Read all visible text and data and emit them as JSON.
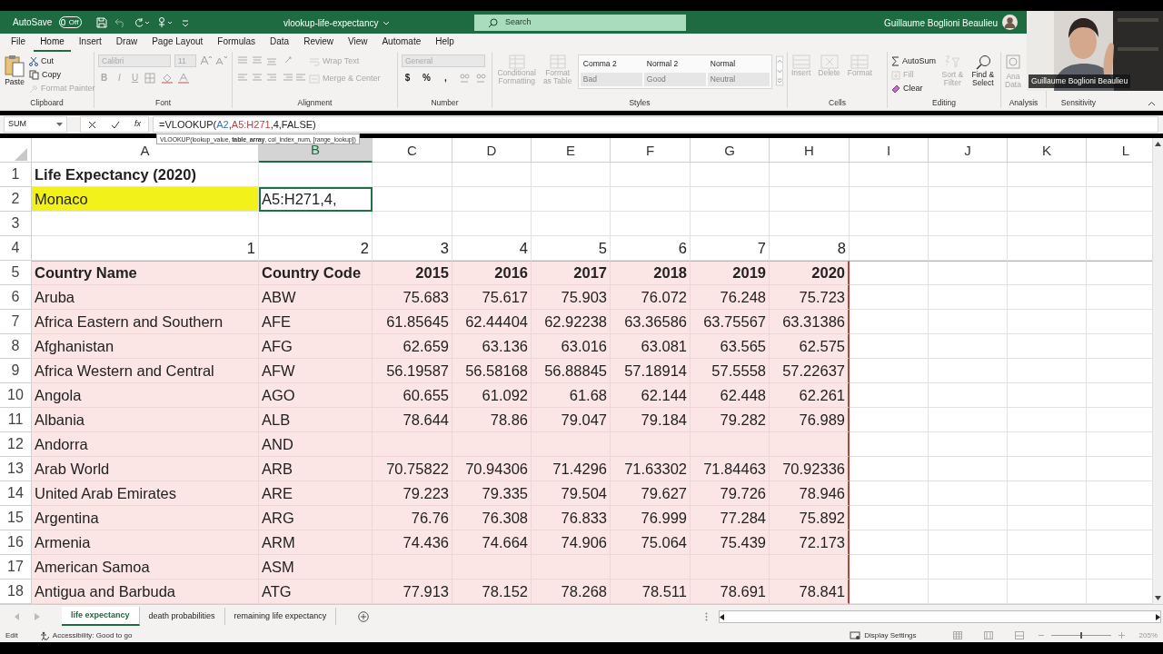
{
  "title_bar": {
    "autosave": "AutoSave",
    "autosave_toggle": {
      "label": "Off",
      "on": false
    },
    "file_name": "vlookup-life-expectancy",
    "search": {
      "placeholder": "Search"
    },
    "user": "Guillaume Boglioni Beaulieu"
  },
  "menu": [
    {
      "label": "File",
      "selected": false
    },
    {
      "label": "Home",
      "selected": true
    },
    {
      "label": "Insert",
      "selected": false
    },
    {
      "label": "Draw",
      "selected": false
    },
    {
      "label": "Page Layout",
      "selected": false
    },
    {
      "label": "Formulas",
      "selected": false
    },
    {
      "label": "Data",
      "selected": false
    },
    {
      "label": "Review",
      "selected": false
    },
    {
      "label": "View",
      "selected": false
    },
    {
      "label": "Automate",
      "selected": false
    },
    {
      "label": "Help",
      "selected": false
    }
  ],
  "ribbon": {
    "groups": [
      {
        "label": "Clipboard",
        "controls": [
          {
            "label": "Paste",
            "disabled": false
          },
          {
            "label": "Cut",
            "disabled": false
          },
          {
            "label": "Copy",
            "disabled": false
          },
          {
            "label": "Format Painter",
            "disabled": true
          }
        ]
      },
      {
        "label": "Font",
        "controls": [
          {
            "label": "Calibri",
            "disabled": true
          },
          {
            "label": "11",
            "disabled": true
          },
          {
            "label": "B",
            "disabled": true
          },
          {
            "label": "I",
            "disabled": true
          },
          {
            "label": "U",
            "disabled": true
          }
        ]
      },
      {
        "label": "Alignment",
        "controls": [
          {
            "label": "Wrap Text",
            "disabled": true
          },
          {
            "label": "Merge & Center",
            "disabled": true
          }
        ]
      },
      {
        "label": "Number",
        "controls": [
          {
            "label": "General",
            "disabled": true
          },
          {
            "label": "$",
            "disabled": false
          },
          {
            "label": "%",
            "disabled": false
          },
          {
            "label": ",",
            "disabled": false
          }
        ]
      },
      {
        "label": "Styles",
        "controls": [
          {
            "label": "Conditional Formatting",
            "disabled": true
          },
          {
            "label": "Format as Table",
            "disabled": true
          }
        ],
        "gallery": [
          {
            "label": "Comma 2",
            "disabled": false
          },
          {
            "label": "Normal 2",
            "disabled": false
          },
          {
            "label": "Normal",
            "disabled": false
          },
          {
            "label": "Bad",
            "disabled": true
          },
          {
            "label": "Good",
            "disabled": true
          },
          {
            "label": "Neutral",
            "disabled": true
          }
        ]
      },
      {
        "label": "Cells",
        "controls": [
          {
            "label": "Insert",
            "disabled": true
          },
          {
            "label": "Delete",
            "disabled": true
          },
          {
            "label": "Format",
            "disabled": true
          }
        ]
      },
      {
        "label": "Editing",
        "controls": [
          {
            "label": "AutoSum",
            "disabled": false
          },
          {
            "label": "Fill",
            "disabled": true
          },
          {
            "label": "Clear",
            "disabled": false
          },
          {
            "label": "Sort & Filter",
            "disabled": true
          },
          {
            "label": "Find & Select",
            "disabled": false
          }
        ]
      },
      {
        "label": "Analysis",
        "controls": [
          {
            "label": "Ana",
            "disabled": true
          },
          {
            "label": "Data",
            "disabled": true
          }
        ]
      },
      {
        "label": "Sensitivity"
      }
    ]
  },
  "formula_bar": {
    "name_box": "SUM",
    "function_button": "fx",
    "formula": [
      {
        "text": "=VLOOKUP("
      },
      {
        "text": "A2",
        "color": "#3f6fb5"
      },
      {
        "text": ","
      },
      {
        "text": "A5:H271",
        "color": "#b5404a"
      },
      {
        "text": ",4,FALSE)"
      }
    ],
    "tooltip": "VLOOKUP(lookup_value, **table_array**, col_index_num, [range_lookup])"
  },
  "sheet": {
    "columns": [
      {
        "label": "A",
        "selected": false
      },
      {
        "label": "B",
        "selected": true
      },
      {
        "label": "C",
        "selected": false
      },
      {
        "label": "D",
        "selected": false
      },
      {
        "label": "E",
        "selected": false
      },
      {
        "label": "F",
        "selected": false
      },
      {
        "label": "G",
        "selected": false
      },
      {
        "label": "H",
        "selected": false
      },
      {
        "label": "I",
        "selected": false
      },
      {
        "label": "J",
        "selected": false
      },
      {
        "label": "K",
        "selected": false
      },
      {
        "label": "L",
        "selected": false
      }
    ],
    "rows": [
      {
        "number": "1",
        "kind": "title",
        "cells": [
          "Life Expectancy (2020)"
        ]
      },
      {
        "number": "2",
        "kind": "input",
        "cells": [
          "Monaco",
          "A5:H271,4,"
        ]
      },
      {
        "number": "3",
        "kind": "blank"
      },
      {
        "number": "4",
        "kind": "index",
        "cells": [
          "1",
          "2",
          "3",
          "4",
          "5",
          "6",
          "7",
          "8"
        ]
      },
      {
        "number": "5",
        "kind": "header",
        "cells": [
          "Country Name",
          "Country Code",
          "2015",
          "2016",
          "2017",
          "2018",
          "2019",
          "2020"
        ]
      },
      {
        "number": "6",
        "kind": "data",
        "cells": [
          "Aruba",
          "ABW",
          "75.683",
          "75.617",
          "75.903",
          "76.072",
          "76.248",
          "75.723"
        ]
      },
      {
        "number": "7",
        "kind": "data",
        "cells": [
          "Africa Eastern and Southern",
          "AFE",
          "61.85645",
          "62.44404",
          "62.92238",
          "63.36586",
          "63.75567",
          "63.31386"
        ]
      },
      {
        "number": "8",
        "kind": "data",
        "cells": [
          "Afghanistan",
          "AFG",
          "62.659",
          "63.136",
          "63.016",
          "63.081",
          "63.565",
          "62.575"
        ]
      },
      {
        "number": "9",
        "kind": "data",
        "cells": [
          "Africa Western and Central",
          "AFW",
          "56.19587",
          "56.58168",
          "56.88845",
          "57.18914",
          "57.5558",
          "57.22637"
        ]
      },
      {
        "number": "10",
        "kind": "data",
        "cells": [
          "Angola",
          "AGO",
          "60.655",
          "61.092",
          "61.68",
          "62.144",
          "62.448",
          "62.261"
        ]
      },
      {
        "number": "11",
        "kind": "data",
        "cells": [
          "Albania",
          "ALB",
          "78.644",
          "78.86",
          "79.047",
          "79.184",
          "79.282",
          "76.989"
        ]
      },
      {
        "number": "12",
        "kind": "data",
        "cells": [
          "Andorra",
          "AND"
        ]
      },
      {
        "number": "13",
        "kind": "data",
        "cells": [
          "Arab World",
          "ARB",
          "70.75822",
          "70.94306",
          "71.4296",
          "71.63302",
          "71.84463",
          "70.92336"
        ]
      },
      {
        "number": "14",
        "kind": "data",
        "cells": [
          "United Arab Emirates",
          "ARE",
          "79.223",
          "79.335",
          "79.504",
          "79.627",
          "79.726",
          "78.946"
        ]
      },
      {
        "number": "15",
        "kind": "data",
        "cells": [
          "Argentina",
          "ARG",
          "76.76",
          "76.308",
          "76.833",
          "76.999",
          "77.284",
          "75.892"
        ]
      },
      {
        "number": "16",
        "kind": "data",
        "cells": [
          "Armenia",
          "ARM",
          "74.436",
          "74.664",
          "74.906",
          "75.064",
          "75.439",
          "72.173"
        ]
      },
      {
        "number": "17",
        "kind": "data",
        "cells": [
          "American Samoa",
          "ASM"
        ]
      },
      {
        "number": "18",
        "kind": "data",
        "cells": [
          "Antigua and Barbuda",
          "ATG",
          "77.913",
          "78.152",
          "78.268",
          "78.511",
          "78.691",
          "78.841"
        ]
      }
    ]
  },
  "sheet_tabs": [
    {
      "label": "life expectancy",
      "selected": true
    },
    {
      "label": "death probabilities",
      "selected": false
    },
    {
      "label": "remaining life expectancy",
      "selected": false
    }
  ],
  "status_bar": {
    "mode": "Edit",
    "accessibility": "Accessibility: Good to go",
    "display_settings": "Display Settings",
    "zoom_slider": {
      "level": 0.5
    },
    "zoom": "205%"
  },
  "webcam": {
    "kind": "picture",
    "participant": "Guillaume Boglioni Beaulieu"
  }
}
